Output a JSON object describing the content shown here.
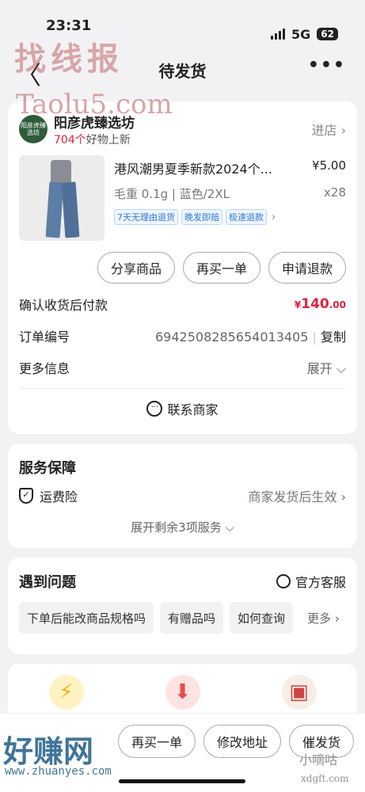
{
  "status_bar": {
    "time": "23:31",
    "network": "5G",
    "battery": "62"
  },
  "nav": {
    "back_glyph": "〈",
    "title": "待发货",
    "more_glyph": "•••"
  },
  "watermarks": {
    "top": "找线报",
    "mid": "Taolu5.com",
    "bottom_left": "好赚网",
    "bottom_url": "www.zhuanyes.com",
    "bottom_right": "小嘀咕",
    "bottom_right_url": "xdgft.com"
  },
  "shop": {
    "logo_text": "阳彦虎臻选坊",
    "name": "阳彦虎臻选坊",
    "new_count": "704个",
    "new_label": "好物上新",
    "enter_label": "进店 ›"
  },
  "product": {
    "title": "港风潮男夏季新款2024个...",
    "price": "¥5.00",
    "spec": "毛重 0.1g | 蓝色/2XL",
    "qty": "x28",
    "tags": [
      "7天无理由退货",
      "晚发即赔",
      "极速退款"
    ],
    "tags_more": "›"
  },
  "actions": {
    "share": "分享商品",
    "rebuy": "再买一单",
    "refund": "申请退款"
  },
  "order": {
    "pay_label": "确认收货后付款",
    "pay_symbol": "¥",
    "pay_int": "140",
    "pay_dec": ".00",
    "number_label": "订单编号",
    "number_value": "6942508285654013405",
    "copy_label": "复制",
    "more_label": "更多信息",
    "expand_label": "展开 ⌵",
    "contact_label": "联系商家"
  },
  "service": {
    "title": "服务保障",
    "item_label": "运费险",
    "item_value": "商家发货后生效 ›",
    "expand_label": "展开剩余3项服务 ⌵"
  },
  "issues": {
    "title": "遇到问题",
    "support_label": "官方客服",
    "chips": [
      "下单后能改商品规格吗",
      "有赠品吗",
      "如何查询"
    ],
    "more_label": "更多 ›"
  },
  "promo": {
    "icons": [
      "lightning-icon",
      "down-arrow-icon",
      "product-icon"
    ]
  },
  "bottom": {
    "rebuy": "再买一单",
    "change_address": "修改地址",
    "urge": "催发货"
  }
}
